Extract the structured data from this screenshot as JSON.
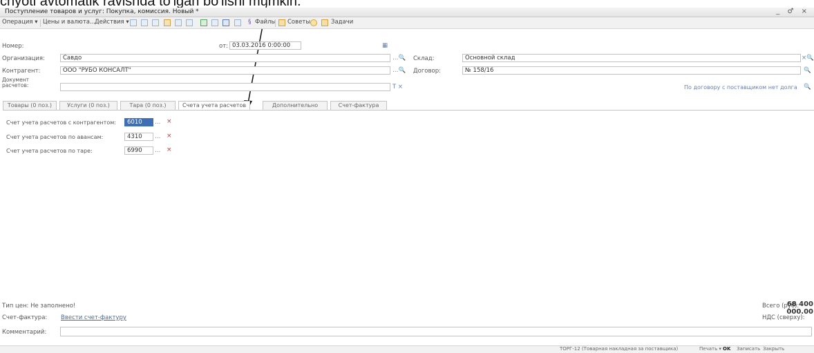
{
  "caption": "chyoti avtomatik ravishda to'lgan bo'lishi mumkin.",
  "window": {
    "title": "Поступление товаров и услуг: Покупка, комиссия. Новый *",
    "controls": "_ ♂ ×"
  },
  "toolbar": {
    "operation": "Операция ▾",
    "prices": "Цены и валюта...",
    "actions": "Действия ▾",
    "files": "Файлы",
    "advice": "Советы",
    "tasks": "Задачи"
  },
  "header": {
    "number_label": "Номер:",
    "from_label": "от:",
    "date_value": "03.03.2016 0:00:00",
    "org_label": "Организация:",
    "org_value": "Савдо",
    "counterparty_label": "Контрагент:",
    "counterparty_value": "ООО \"РУБО КОНСАЛТ\"",
    "settlement_doc_label": "Документ расчетов:",
    "warehouse_label": "Склад:",
    "warehouse_value": "Основной склад",
    "contract_label": "Договор:",
    "contract_value": "№ 158/16",
    "contract_note": "По договору с поставщиком нет долга"
  },
  "tabs": [
    {
      "label": "Товары (0 поз.)"
    },
    {
      "label": "Услуги (0 поз.)"
    },
    {
      "label": "Тара (0 поз.)"
    },
    {
      "label": "Счета учета расчетов"
    },
    {
      "label": "Дополнительно"
    },
    {
      "label": "Счет-фактура"
    }
  ],
  "accounts": [
    {
      "label": "Счет учета расчетов с контрагентом:",
      "value": "6010"
    },
    {
      "label": "Счет учета расчетов по авансам:",
      "value": "4310"
    },
    {
      "label": "Счет учета расчетов по таре:",
      "value": "6990"
    }
  ],
  "footer": {
    "price_type": "Тип цен: Не заполнено!",
    "invoice_label": "Счет-фактура:",
    "invoice_link": "Ввести счет-фактуру",
    "comment_label": "Комментарий:",
    "total_label": "Всего (руб):",
    "total_value": "68 400 000.00",
    "vat_label": "НДС (сверху):"
  },
  "bottom_bar": {
    "print_form": "ТОРГ-12 (Товарная накладная за поставщика)",
    "print": "Печать ▾",
    "ok": "OK",
    "save": "Записать",
    "close": "Закрыть"
  }
}
